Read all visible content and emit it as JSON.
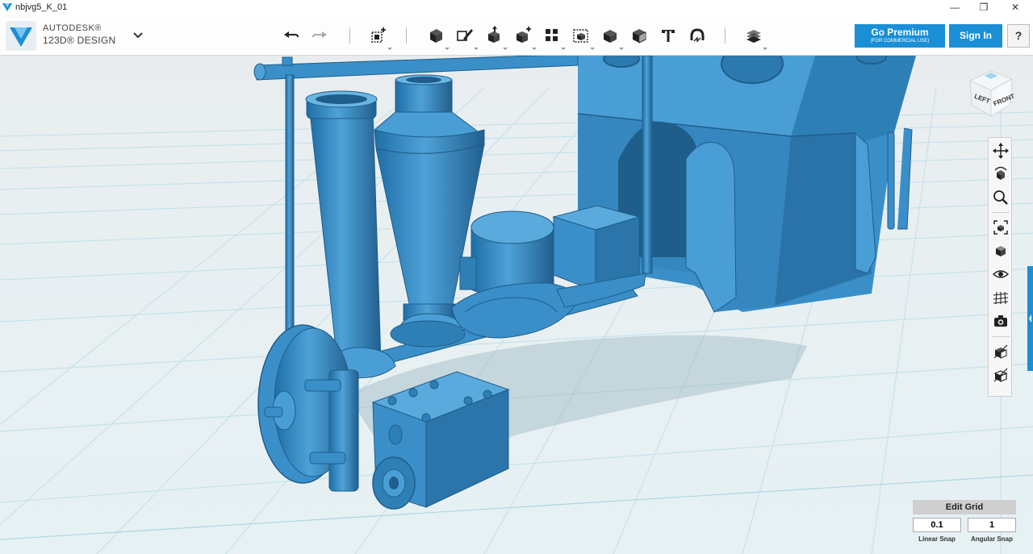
{
  "window": {
    "title": "nbjvg5_K_01",
    "minimize": "—",
    "maximize": "❐",
    "close": "✕"
  },
  "brand": {
    "line1": "AUTODESK®",
    "line2": "123D® DESIGN"
  },
  "toolbar": {
    "tools": [
      "undo",
      "redo",
      "transform",
      "primitives",
      "sketch",
      "construct",
      "modify",
      "pattern",
      "grouping",
      "combine",
      "measure",
      "text",
      "snap",
      "materials"
    ]
  },
  "buttons": {
    "premium_title": "Go Premium",
    "premium_sub": "(FOR COMMERCIAL USE)",
    "signin": "Sign In",
    "help": "?"
  },
  "viewcube": {
    "left": "LEFT",
    "front": "FRONT"
  },
  "grid": {
    "edit_label": "Edit Grid",
    "linear_value": "0.1",
    "angular_value": "1",
    "linear_label": "Linear Snap",
    "angular_label": "Angular Snap"
  },
  "colors": {
    "accent": "#1a8fd6",
    "model": "#3a8fc9",
    "model_dark": "#1f5d8a",
    "grid_line": "#bfe0ea"
  }
}
